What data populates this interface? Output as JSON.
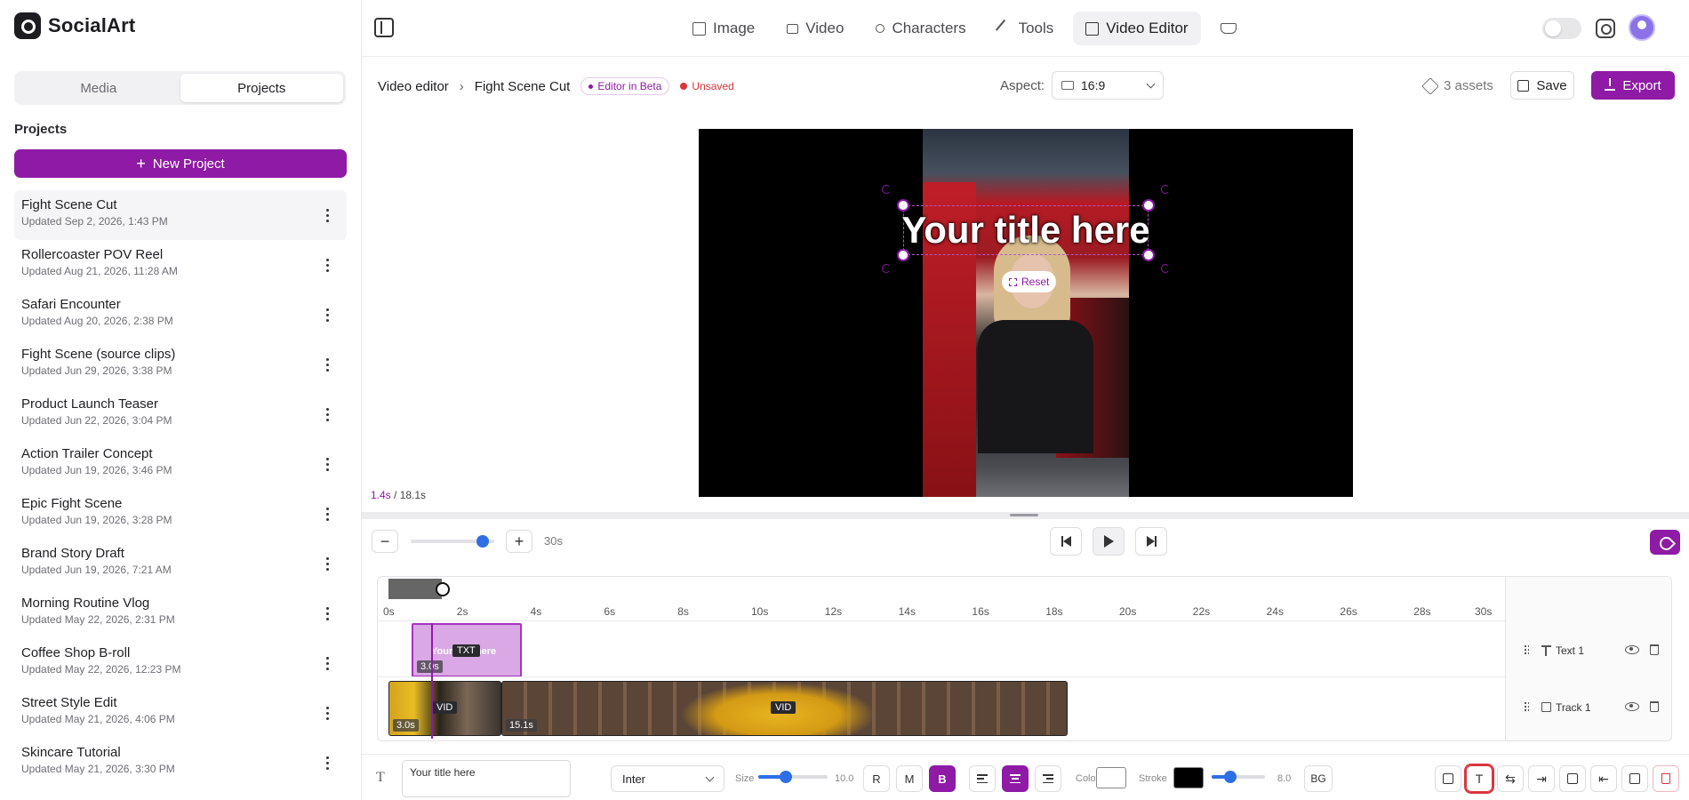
{
  "brand": {
    "name": "SocialArt"
  },
  "sidebar": {
    "tabs": [
      {
        "label": "Media"
      },
      {
        "label": "Projects"
      }
    ],
    "projects_title": "Projects",
    "new_project_label": "New Project",
    "projects": [
      {
        "name": "Fight Scene Cut",
        "updated": "Updated Sep 2, 2026, 1:43 PM"
      },
      {
        "name": "Rollercoaster POV Reel",
        "updated": "Updated Aug 21, 2026, 11:28 AM"
      },
      {
        "name": "Safari Encounter",
        "updated": "Updated Aug 20, 2026, 2:38 PM"
      },
      {
        "name": "Fight Scene (source clips)",
        "updated": "Updated Jun 29, 2026, 3:38 PM"
      },
      {
        "name": "Product Launch Teaser",
        "updated": "Updated Jun 22, 2026, 3:04 PM"
      },
      {
        "name": "Action Trailer Concept",
        "updated": "Updated Jun 19, 2026, 3:46 PM"
      },
      {
        "name": "Epic Fight Scene",
        "updated": "Updated Jun 19, 2026, 3:28 PM"
      },
      {
        "name": "Brand Story Draft",
        "updated": "Updated Jun 19, 2026, 7:21 AM"
      },
      {
        "name": "Morning Routine Vlog",
        "updated": "Updated May 22, 2026, 2:31 PM"
      },
      {
        "name": "Coffee Shop B-roll",
        "updated": "Updated May 22, 2026, 12:23 PM"
      },
      {
        "name": "Street Style Edit",
        "updated": "Updated May 21, 2026, 4:06 PM"
      },
      {
        "name": "Skincare Tutorial",
        "updated": "Updated May 21, 2026, 3:30 PM"
      }
    ]
  },
  "nav": {
    "tabs": [
      {
        "label": "Image",
        "icon": "image-icon"
      },
      {
        "label": "Video",
        "icon": "video-camera-icon"
      },
      {
        "label": "Characters",
        "icon": "person-icon"
      },
      {
        "label": "Tools",
        "icon": "wrench-icon"
      },
      {
        "label": "Video Editor",
        "icon": "film-icon"
      }
    ],
    "active_tab": "Video Editor"
  },
  "editor": {
    "breadcrumb_root": "Video editor",
    "project_name": "Fight Scene Cut",
    "beta_badge": "Editor in Beta",
    "unsaved_label": "Unsaved",
    "aspect_label": "Aspect:",
    "aspect_value": "16:9",
    "assets_label": "3 assets",
    "save_label": "Save",
    "export_label": "Export"
  },
  "preview": {
    "title_text": "Your title here",
    "reset_label": "Reset",
    "current_time": "1.4s",
    "total_time": "/ 18.1s"
  },
  "transport": {
    "zoom_level": 0.82,
    "zoom_label": "30s"
  },
  "timeline": {
    "ticks": [
      "0s",
      "2s",
      "4s",
      "6s",
      "8s",
      "10s",
      "12s",
      "14s",
      "16s",
      "18s",
      "20s",
      "22s",
      "24s",
      "26s",
      "28s",
      "30s"
    ],
    "text_clip": {
      "ghost_text": "Your title here",
      "tag": "TXT",
      "duration": "3.0s"
    },
    "video_clips": [
      {
        "tag": "VID",
        "duration": "3.0s"
      },
      {
        "tag": "VID",
        "duration": "15.1s"
      }
    ],
    "tracks": [
      {
        "name": "Text 1"
      },
      {
        "name": "Track 1"
      }
    ]
  },
  "toolbar": {
    "text_value": "Your title here",
    "font": "Inter",
    "size_label": "Size",
    "size_value": "10.0",
    "weight_buttons": [
      "R",
      "M",
      "B"
    ],
    "color_label": "Color",
    "stroke_label": "Stroke",
    "stroke_value": "8.0",
    "bg_label": "BG",
    "colors": {
      "text": "#ffffff",
      "stroke": "#000000"
    }
  },
  "colors": {
    "accent": "#8e1aa5",
    "danger": "#d9363e",
    "slider": "#2e6fe6"
  }
}
